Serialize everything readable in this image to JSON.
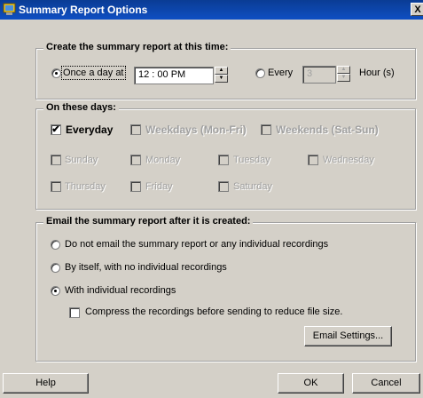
{
  "window": {
    "title": "Summary Report Options",
    "close_label": "X"
  },
  "schedule": {
    "legend": "Create the summary report at this time:",
    "once_label": "Once a day at",
    "time_value": "12 : 00  PM",
    "every_label": "Every",
    "every_value": "3",
    "hours_label": "Hour (s)"
  },
  "days": {
    "legend": "On these days:",
    "everyday": "Everyday",
    "weekdays": "Weekdays (Mon-Fri)",
    "weekends": "Weekends (Sat-Sun)",
    "sunday": "Sunday",
    "monday": "Monday",
    "tuesday": "Tuesday",
    "wednesday": "Wednesday",
    "thursday": "Thursday",
    "friday": "Friday",
    "saturday": "Saturday",
    "check_mark": "✔"
  },
  "email": {
    "legend": "Email the summary report after it is created:",
    "opt_none": "Do not email the summary report or any individual recordings",
    "opt_itself": "By itself, with no individual recordings",
    "opt_with": "With individual recordings",
    "compress": "Compress the recordings before sending to reduce file size.",
    "settings_button": "Email Settings..."
  },
  "footer": {
    "help": "Help",
    "ok": "OK",
    "cancel": "Cancel"
  }
}
